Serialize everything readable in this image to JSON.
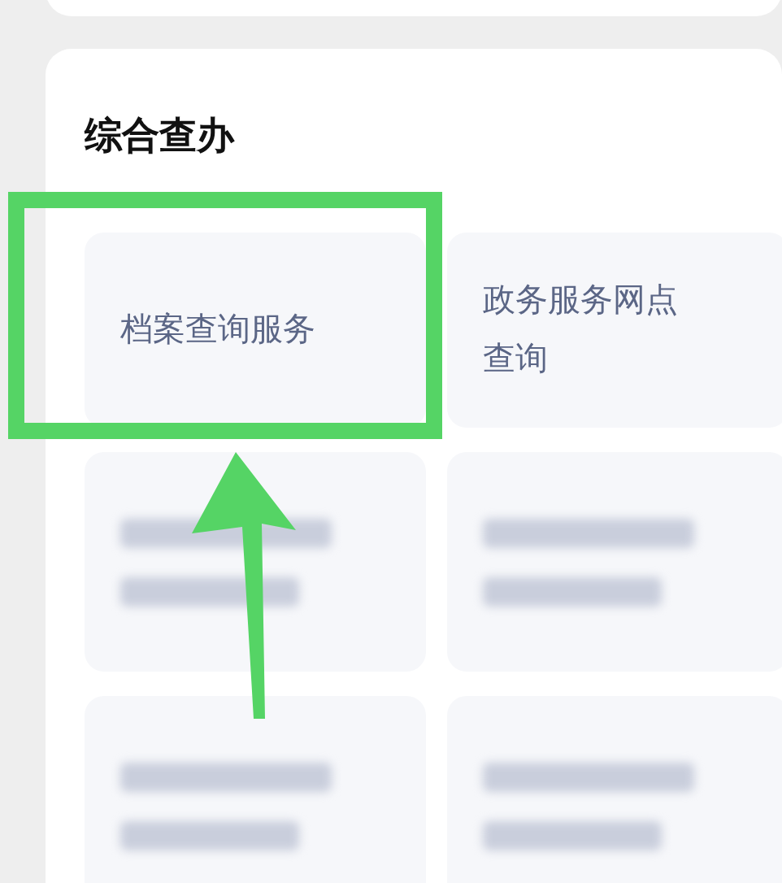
{
  "section": {
    "title": "综合查办"
  },
  "services": [
    {
      "kind": "text",
      "label": "档案查询服务",
      "highlighted": true
    },
    {
      "kind": "text",
      "label": "政务服务网点查询",
      "highlighted": false
    },
    {
      "kind": "blurred"
    },
    {
      "kind": "blurred"
    },
    {
      "kind": "blurred"
    },
    {
      "kind": "blurred"
    }
  ]
}
